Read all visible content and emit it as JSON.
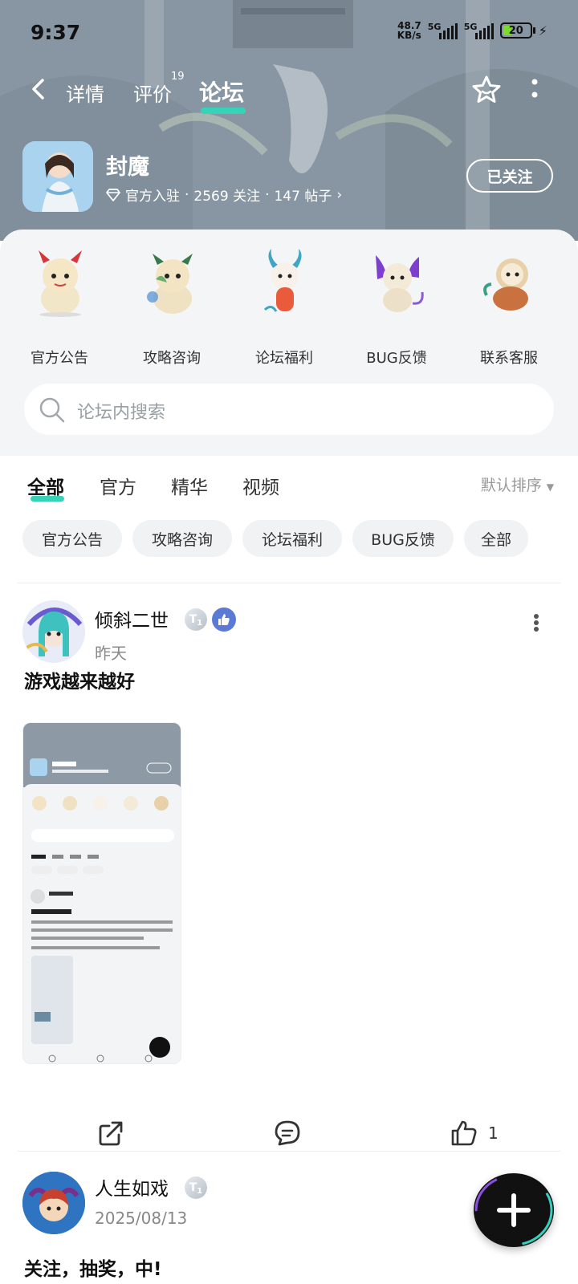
{
  "status_bar": {
    "time": "9:37",
    "net_speed_value": "48.7",
    "net_speed_unit": "KB/s",
    "sim1": "5G",
    "sim2": "5G",
    "battery": "20"
  },
  "nav": {
    "tabs": [
      "详情",
      "评价",
      "论坛"
    ],
    "review_count": "19",
    "active_tab": "论坛"
  },
  "app": {
    "name": "封魔",
    "official": "官方入驻",
    "followers": "2569 关注",
    "posts": "147 帖子",
    "follow_label": "已关注"
  },
  "categories": [
    {
      "label": "官方公告",
      "icon": "dragon-mascot-red-horns"
    },
    {
      "label": "攻略咨询",
      "icon": "dragon-mascot-green"
    },
    {
      "label": "论坛福利",
      "icon": "dragon-mascot-white-blue-horns"
    },
    {
      "label": "BUG反馈",
      "icon": "dragon-mascot-purple-wings"
    },
    {
      "label": "联系客服",
      "icon": "dragon-mascot-lion"
    }
  ],
  "search": {
    "placeholder": "论坛内搜索"
  },
  "filters": {
    "tabs": [
      "全部",
      "官方",
      "精华",
      "视频"
    ],
    "sort": "默认排序"
  },
  "chips": [
    "官方公告",
    "攻略咨询",
    "论坛福利",
    "BUG反馈",
    "全部"
  ],
  "posts": [
    {
      "author": "倾斜二世",
      "level": "1",
      "date": "昨天",
      "title": "游戏越来越好",
      "likes": "1"
    },
    {
      "author": "人生如戏",
      "level": "1",
      "date": "2025/08/13",
      "title": "关注，抽奖，中!"
    }
  ],
  "colors": {
    "accent": "#36d3b8",
    "hero": "#8796a2",
    "panel": "#f4f5f7"
  }
}
